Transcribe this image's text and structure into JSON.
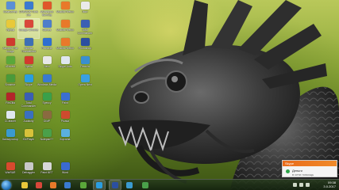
{
  "desktop": {
    "icons": [
      {
        "label": "Компьютер",
        "color": "#5a8fd6",
        "icon": "computer-icon"
      },
      {
        "label": "DAEMON Tools Lite",
        "color": "#3a7ad0",
        "icon": "daemon-tools-icon"
      },
      {
        "label": "Ashampoo Burning",
        "color": "#e0562a",
        "icon": "burning-studio-icon"
      },
      {
        "label": "Mozilla Firefox",
        "color": "#e8792a",
        "icon": "firefox-icon"
      },
      {
        "label": "Лист",
        "color": "#eaeaea",
        "icon": "document-icon"
      },
      {
        "label": "Ярлык",
        "color": "#e8c93a",
        "icon": "folder-icon"
      },
      {
        "label": "Google Chrome",
        "color": "#d9473a",
        "icon": "chrome-icon"
      },
      {
        "label": "Games",
        "color": "#4f7ec9",
        "icon": "games-icon"
      },
      {
        "label": "Mozilla Firefox",
        "color": "#e8792a",
        "icon": "firefox-icon"
      },
      {
        "label": "Total Commander",
        "color": "#3b5fb3",
        "icon": "total-commander-icon"
      },
      {
        "label": "Acronis True Image",
        "color": "#cf3a2e",
        "icon": "acronis-icon"
      },
      {
        "label": "Mozilla Thunderbird",
        "color": "#3d6fb5",
        "icon": "thunderbird-icon"
      },
      {
        "label": "Pinnacle",
        "color": "#2f6fd0",
        "icon": "pinnacle-icon"
      },
      {
        "label": "Mozilla Firefox",
        "color": "#e8792a",
        "icon": "firefox-icon"
      },
      {
        "label": "Photoshop",
        "color": "#2b4fa0",
        "icon": "photoshop-icon"
      },
      {
        "label": "uTorrent",
        "color": "#5aa83a",
        "icon": "utorrent-icon"
      },
      {
        "label": "Opera",
        "color": "#d23a2e",
        "icon": "opera-icon"
      },
      {
        "label": "Nero",
        "color": "#e8e8e8",
        "icon": "nero-icon"
      },
      {
        "label": "Skype Auto",
        "color": "#dfe7ef",
        "icon": "skype-icon"
      },
      {
        "label": "Recuva",
        "color": "#3a8fd0",
        "icon": "recuva-icon"
      },
      {
        "label": "Блокнот",
        "color": "#4a9a3a",
        "icon": "notepad-icon"
      },
      {
        "label": "Skype",
        "color": "#2a9de0",
        "icon": "skype-icon"
      },
      {
        "label": "Windows Media",
        "color": "#3a7ad0",
        "icon": "media-player-icon"
      },
      {
        "label": "Opera Next",
        "color": "#3aa0e0",
        "icon": "opera-next-icon"
      },
      {
        "label": "FileZilla",
        "color": "#b3262a",
        "icon": "filezilla-icon"
      },
      {
        "label": "Total Commander",
        "color": "#3b5fb3",
        "icon": "total-commander-icon"
      },
      {
        "label": "Speccy",
        "color": "#3aa04a",
        "icon": "speccy-icon"
      },
      {
        "label": "Paint",
        "color": "#3a6fd0",
        "icon": "paint-icon"
      },
      {
        "label": "CCleaner",
        "color": "#dfe7ef",
        "icon": "ccleaner-icon"
      },
      {
        "label": "Audacity",
        "color": "#3a70c0",
        "icon": "audacity-icon"
      },
      {
        "label": "GIMP",
        "color": "#8a6a40",
        "icon": "gimp-icon"
      },
      {
        "label": "Picasa",
        "color": "#cf4a2e",
        "icon": "picasa-icon"
      },
      {
        "label": "Калькулятор",
        "color": "#3a9ad0",
        "icon": "calculator-icon"
      },
      {
        "label": "KMPlayer",
        "color": "#d8c23a",
        "icon": "kmplayer-icon"
      },
      {
        "label": "Notepad++",
        "color": "#4aa04a",
        "icon": "notepad-plus-icon"
      },
      {
        "label": "Корзина",
        "color": "#5ab0e0",
        "icon": "recycle-bin-icon"
      },
      {
        "label": "WinRAR",
        "color": "#d84a2e",
        "icon": "winrar-icon"
      },
      {
        "label": "Defraggler",
        "color": "#c8c8c8",
        "icon": "defraggler-icon"
      },
      {
        "label": "Paint.NET",
        "color": "#d8d8d8",
        "icon": "paint-net-icon"
      },
      {
        "label": "Word",
        "color": "#3a6ad0",
        "icon": "word-icon"
      }
    ]
  },
  "taskbar": {
    "apps": [
      {
        "icon": "explorer-icon",
        "color": "#e8c93a"
      },
      {
        "icon": "chrome-icon",
        "color": "#d9473a"
      },
      {
        "icon": "firefox-icon",
        "color": "#e8792a"
      },
      {
        "icon": "media-player-icon",
        "color": "#3a7ad0"
      },
      {
        "icon": "utorrent-icon",
        "color": "#5aa83a"
      },
      {
        "icon": "skype-icon",
        "color": "#2a9de0"
      },
      {
        "icon": "photoshop-icon",
        "color": "#2b4fa0"
      },
      {
        "icon": "mozilla-icon",
        "color": "#3a9ad0"
      },
      {
        "icon": "app-icon",
        "color": "#4aa04a"
      }
    ],
    "clock": {
      "time": "09:38",
      "date": "3.0.2017"
    }
  },
  "notification": {
    "title": "Skype",
    "message": "Деньги",
    "sub": "в сети помощь"
  }
}
